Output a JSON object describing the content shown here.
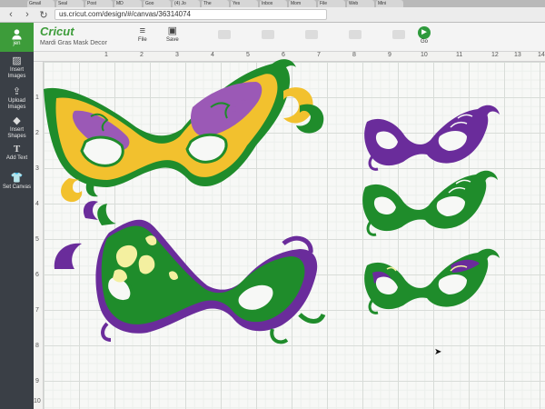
{
  "browser": {
    "tabs": [
      "Gmail",
      "Seal",
      "Post",
      "MD",
      "Goo",
      "(4) Jo",
      "The",
      "Yes",
      "Inbox",
      "Mom",
      "File",
      "Web",
      "Mini"
    ],
    "url": "us.cricut.com/design/#/canvas/36314074"
  },
  "header": {
    "user": "jen",
    "logo": "Cricut",
    "project_name": "Mardi Gras Mask Decor",
    "file_label": "File",
    "save_label": "Save",
    "go_label": "Go"
  },
  "sidebar": {
    "items": [
      {
        "icon": "image-icon",
        "label": "Insert Images"
      },
      {
        "icon": "upload-icon",
        "label": "Upload Images"
      },
      {
        "icon": "shapes-icon",
        "label": "Insert Shapes"
      },
      {
        "icon": "text-icon",
        "label": "Add Text"
      },
      {
        "icon": "shirt-icon",
        "label": "Set Canvas"
      }
    ]
  },
  "ruler": {
    "top": [
      "1",
      "2",
      "3",
      "4",
      "5",
      "6",
      "7",
      "8",
      "9",
      "10",
      "11",
      "12",
      "13",
      "14"
    ],
    "left": [
      "1",
      "2",
      "3",
      "4",
      "5",
      "6",
      "7",
      "8",
      "9",
      "10"
    ]
  },
  "colors": {
    "green": "#1f8c2b",
    "purple": "#6a2c9b",
    "gold": "#f2c12e",
    "pale_yellow": "#f4f0a0",
    "brand_green": "#3d9c3a"
  }
}
